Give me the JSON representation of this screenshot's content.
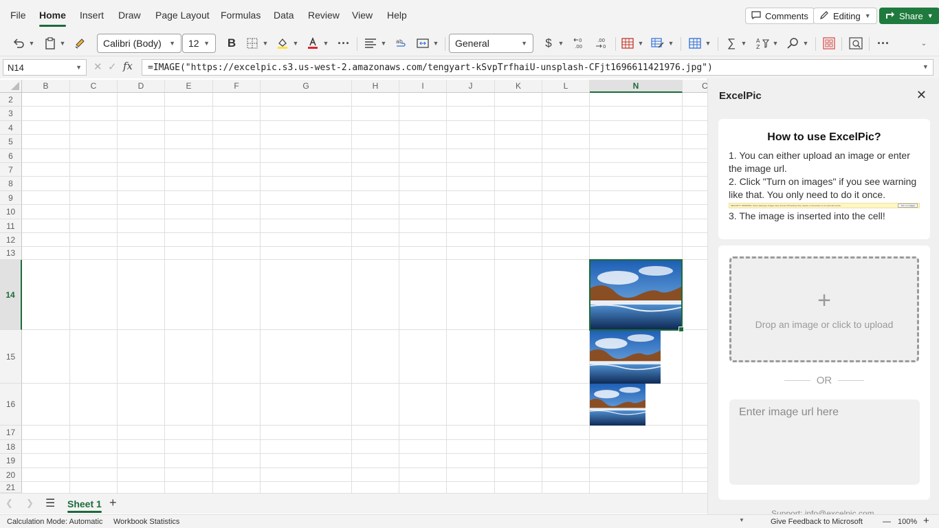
{
  "menu": {
    "items": [
      "File",
      "Home",
      "Insert",
      "Draw",
      "Page Layout",
      "Formulas",
      "Data",
      "Review",
      "View",
      "Help"
    ],
    "active": "Home",
    "comments_label": "Comments",
    "editing_label": "Editing",
    "share_label": "Share"
  },
  "toolbar": {
    "font_name": "Calibri (Body)",
    "font_size": "12",
    "bold_label": "B",
    "number_format": "General",
    "currency_symbol": "$",
    "increase_decimal": "←0 .00",
    "decrease_decimal": ".00 →0",
    "more_label": "···"
  },
  "formula_bar": {
    "name_box": "N14",
    "fx_label": "fx",
    "formula": "=IMAGE(\"https://excelpic.s3.us-west-2.amazonaws.com/tengyart-kSvpTrfhaiU-unsplash-CFjt1696611421976.jpg\")"
  },
  "grid": {
    "columns": [
      "B",
      "C",
      "D",
      "E",
      "F",
      "G",
      "H",
      "I",
      "J",
      "K",
      "L",
      "N",
      "C"
    ],
    "active_column": "N",
    "rows": [
      "2",
      "3",
      "4",
      "5",
      "6",
      "7",
      "8",
      "9",
      "10",
      "11",
      "12",
      "13",
      "14",
      "15",
      "16",
      "17",
      "18",
      "19",
      "20",
      "21"
    ],
    "active_row": "14"
  },
  "sheets": {
    "tabs": [
      "Sheet 1"
    ],
    "active": "Sheet 1",
    "add_label": "+"
  },
  "status": {
    "calc_mode": "Calculation Mode: Automatic",
    "workbook_stats": "Workbook Statistics",
    "feedback": "Give Feedback to Microsoft",
    "zoom": "100%",
    "zoom_minus": "—",
    "zoom_plus": "+"
  },
  "pane": {
    "title": "ExcelPic",
    "close_label": "✕",
    "howto_title": "How to use ExcelPic?",
    "step1": "1. You can either upload an image or enter the image url.",
    "step2": "2. Click \"Turn on images\" if you see warning like that. You only need to do it once.",
    "warning_text": "SECURITY WARNING: Some data type images were turned off because they require a connection to an external source.",
    "warning_button": "Turn on images",
    "step3": "3. The image is inserted into the cell!",
    "upload_plus": "+",
    "upload_label": "Drop an image or click to upload",
    "or_label": "OR",
    "url_placeholder": "Enter image url here",
    "support": "Support: info@excelpic.com"
  },
  "colors": {
    "accent": "#1b6b3a",
    "share": "#1f7a3d",
    "chrome": "#f3f3f3"
  }
}
